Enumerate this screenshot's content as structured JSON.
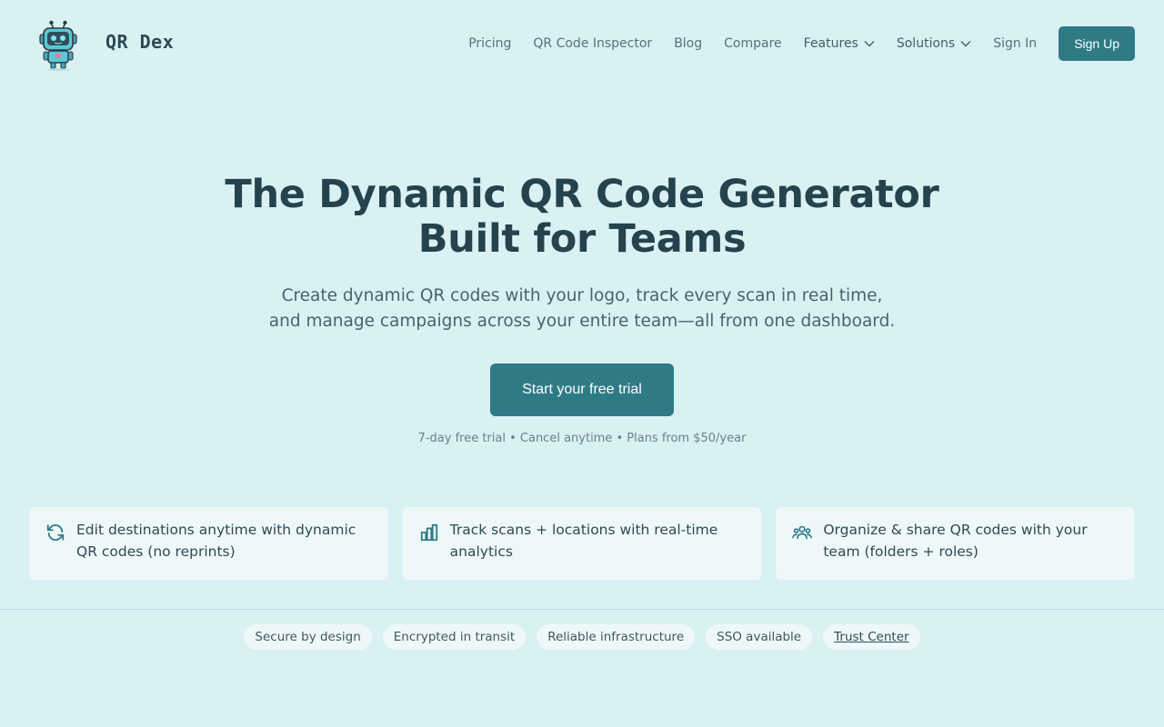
{
  "brand": {
    "name": "QR Dex",
    "logo_icon": "robot-icon"
  },
  "nav": {
    "items": [
      {
        "label": "Pricing"
      },
      {
        "label": "QR Code Inspector"
      },
      {
        "label": "Blog"
      },
      {
        "label": "Compare"
      },
      {
        "label": "Features",
        "dropdown": true
      },
      {
        "label": "Solutions",
        "dropdown": true
      },
      {
        "label": "Sign In"
      }
    ],
    "signup_label": "Sign Up"
  },
  "hero": {
    "title_line1": "The Dynamic QR Code Generator",
    "title_line2": "Built for Teams",
    "subtitle": "Create dynamic QR codes with your logo, track every scan in real time, and manage campaigns across your entire team—all from one dashboard.",
    "cta_label": "Start your free trial",
    "note": "7-day free trial • Cancel anytime • Plans from $50/year"
  },
  "features": [
    {
      "icon": "refresh-icon",
      "text": "Edit destinations anytime with dynamic QR codes (no reprints)"
    },
    {
      "icon": "bar-chart-icon",
      "text": "Track scans + locations with real-time analytics"
    },
    {
      "icon": "team-icon",
      "text": "Organize & share QR codes with your team (folders + roles)"
    }
  ],
  "trust": {
    "pills": [
      "Secure by design",
      "Encrypted in transit",
      "Reliable infrastructure",
      "SSO available"
    ],
    "link_label": "Trust Center"
  },
  "colors": {
    "background": "#daf1f4",
    "accent": "#2e7b86",
    "heading": "#25434d",
    "card": "#eef8f9"
  }
}
